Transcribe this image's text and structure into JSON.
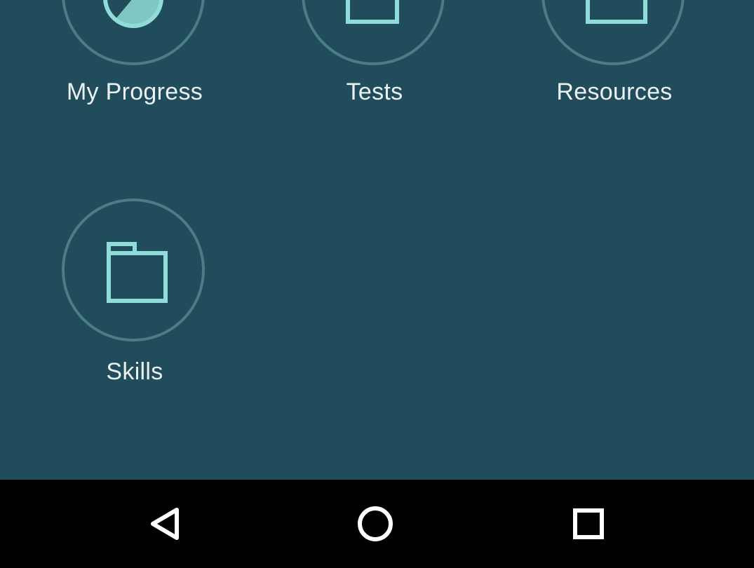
{
  "colors": {
    "background": "#214c5b",
    "circle_border": "#4c7c85",
    "icon_stroke": "#8fdcd8",
    "label_text": "#ebf1f1",
    "navbar": "#000000",
    "nav_icon": "#ffffff"
  },
  "menu": {
    "items": [
      {
        "label": "My Progress",
        "icon": "pie-chart-icon"
      },
      {
        "label": "Tests",
        "icon": "documents-icon"
      },
      {
        "label": "Resources",
        "icon": "box-icon"
      },
      {
        "label": "Skills",
        "icon": "folder-icon"
      }
    ]
  },
  "navbar": {
    "buttons": [
      {
        "icon": "back-icon"
      },
      {
        "icon": "home-icon"
      },
      {
        "icon": "recents-icon"
      }
    ]
  }
}
